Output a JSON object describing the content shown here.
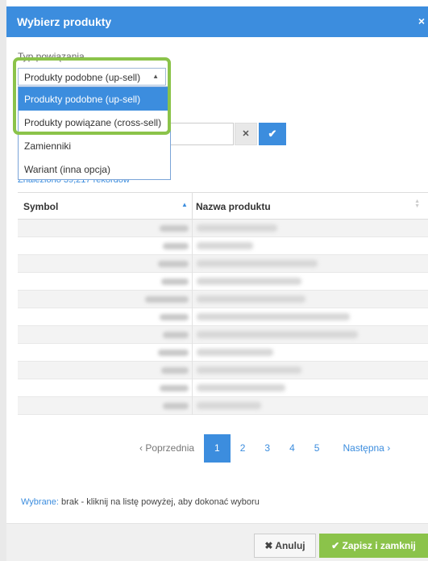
{
  "modal": {
    "title": "Wybierz produkty",
    "close_icon": "×"
  },
  "relation": {
    "label": "Typ powiązania",
    "selected": "Produkty podobne (up-sell)",
    "options": [
      "Produkty podobne (up-sell)",
      "Produkty powiązane (cross-sell)",
      "Zamienniki",
      "Wariant (inna opcja)"
    ]
  },
  "search": {
    "clear_icon": "✕",
    "confirm_icon": "✔"
  },
  "found_text": "Znaleziono 39,217 rekordów",
  "table": {
    "columns": [
      "Symbol",
      "Nazwa produktu"
    ],
    "row_count": 11
  },
  "pagination": {
    "prev": "‹ Poprzednia",
    "pages": [
      "1",
      "2",
      "3",
      "4",
      "5"
    ],
    "current": "1",
    "next": "Następna ›"
  },
  "selection": {
    "label": "Wybrane:",
    "text": "brak - kliknij na listę powyżej, aby dokonać wyboru"
  },
  "footer": {
    "cancel_icon": "✖",
    "cancel_label": "Anuluj",
    "save_icon": "✔",
    "save_label": "Zapisz i zamknij"
  },
  "colors": {
    "primary": "#3c8dde",
    "success": "#8bc34a"
  }
}
